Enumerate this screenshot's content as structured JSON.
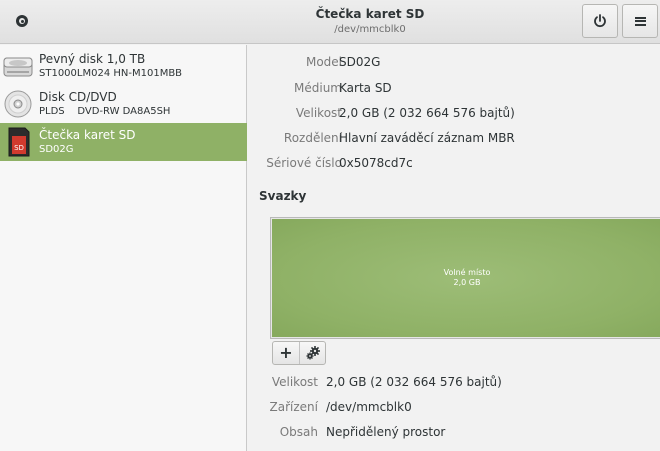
{
  "header": {
    "title": "Čtečka karet SD",
    "subtitle": "/dev/mmcblk0",
    "left_icon": "disc-icon",
    "power_button_icon": "power-icon",
    "menu_button_icon": "hamburger-menu-icon"
  },
  "sidebar": {
    "devices": [
      {
        "name": "Pevný disk 1,0 TB",
        "sub": "ST1000LM024 HN-M101MBB",
        "icon": "hard-disk-icon",
        "selected": false
      },
      {
        "name": "Disk CD/DVD",
        "sub": "PLDS    DVD-RW DA8A5SH",
        "icon": "optical-disc-icon",
        "selected": false
      },
      {
        "name": "Čtečka karet SD",
        "sub": "SD02G",
        "icon": "sd-card-icon",
        "selected": true
      }
    ]
  },
  "details": {
    "model_label": "Model",
    "model_value": "SD02G",
    "medium_label": "Médium",
    "medium_value": "Karta SD",
    "size_label": "Velikost",
    "size_value": "2,0 GB (2 032 664 576 bajtů)",
    "partitioning_label": "Rozdělení",
    "partitioning_value": "Hlavní zaváděcí záznam MBR",
    "serial_label": "Sériové číslo",
    "serial_value": "0x5078cd7c"
  },
  "volumes": {
    "title": "Svazky",
    "free_label": "Volné místo",
    "free_size": "2,0 GB",
    "add_button": "+",
    "settings_icon": "gears-icon"
  },
  "volume_details": {
    "size_label": "Velikost",
    "size_value": "2,0 GB (2 032 664 576 bajtů)",
    "device_label": "Zařízení",
    "device_value": "/dev/mmcblk0",
    "contents_label": "Obsah",
    "contents_value": "Nepřidělený prostor"
  },
  "colors": {
    "accent": "#8fb166",
    "selection_text": "#ffffff"
  }
}
